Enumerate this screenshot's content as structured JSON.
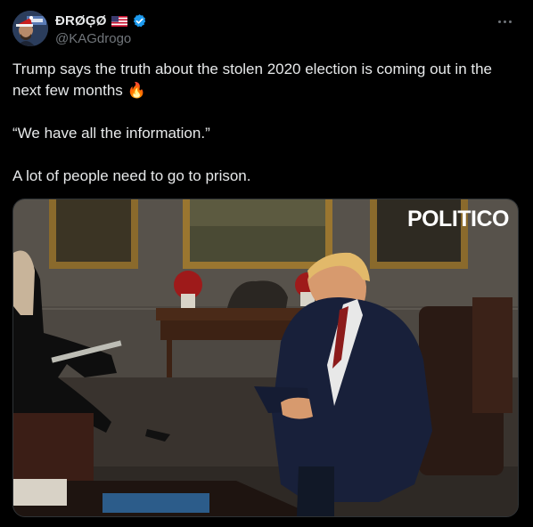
{
  "author": {
    "display_name": "ÐRØĢØ",
    "handle": "@KAGdrogo",
    "flag_icon": "us-flag-icon",
    "verified_color": "#1d9bf0"
  },
  "post": {
    "lines": [
      "Trump says the truth about the stolen 2020 election is coming out in the next few months 🔥",
      "“We have all the information.”",
      "A lot of people need to go to prison."
    ]
  },
  "media": {
    "watermark": "POLITICO"
  },
  "colors": {
    "background": "#000000",
    "text": "#e7e9ea",
    "muted": "#71767b",
    "border": "#2f3336"
  }
}
